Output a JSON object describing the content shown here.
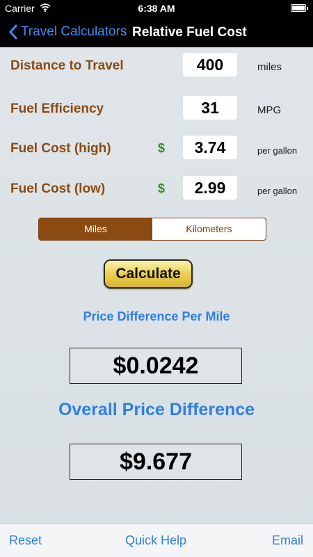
{
  "status_bar": {
    "carrier": "Carrier",
    "time": "6:38 AM"
  },
  "nav": {
    "back_label": "Travel Calculators",
    "title": "Relative Fuel Cost"
  },
  "form": {
    "distance": {
      "label": "Distance to Travel",
      "value": "400",
      "unit": "miles"
    },
    "efficiency": {
      "label": "Fuel Efficiency",
      "value": "31",
      "unit": "MPG"
    },
    "cost_high": {
      "label": "Fuel Cost (high)",
      "currency": "$",
      "value": "3.74",
      "unit": "per gallon"
    },
    "cost_low": {
      "label": "Fuel Cost (low)",
      "currency": "$",
      "value": "2.99",
      "unit": "per gallon"
    }
  },
  "units_toggle": {
    "options": [
      "Miles",
      "Kilometers"
    ],
    "selected": "Miles"
  },
  "calculate_label": "Calculate",
  "results": {
    "per_mile_label": "Price Difference Per Mile",
    "per_mile_value": "$0.0242",
    "overall_label": "Overall Price Difference",
    "overall_value": "$9.677"
  },
  "toolbar": {
    "reset": "Reset",
    "help": "Quick Help",
    "email": "Email"
  },
  "colors": {
    "label_brown": "#8a4a14",
    "accent_blue": "#2f7fe0",
    "dollar_green": "#3a8a2a",
    "segment_active": "#8b4a10"
  }
}
